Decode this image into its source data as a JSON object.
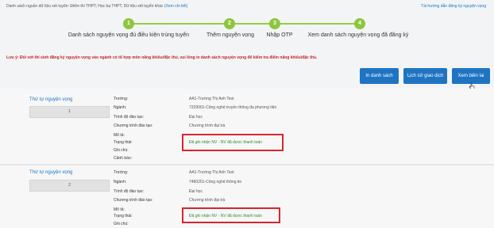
{
  "header": {
    "source_text": "Danh sách nguồn dữ liệu xét tuyển: Điểm thi THPT; Học bạ THPT; Dữ liệu xét tuyển khác",
    "detail_link": "(Xem chi tiết)",
    "guide_link": "Tài hướng dẫn đăng ký nguyện vọng"
  },
  "steps": [
    {
      "num": "1",
      "label": "Danh sách nguyện vọng đủ điều kiện trúng tuyển"
    },
    {
      "num": "2",
      "label": "Thêm nguyện vọng"
    },
    {
      "num": "3",
      "label": "Nhập OTP"
    },
    {
      "num": "4",
      "label": "Xem danh sách nguyện vọng đã đăng ký"
    }
  ],
  "colors": {
    "accent": "#1f74c2",
    "step": "#8dc63f",
    "warning": "#c0262d",
    "highlight_border": "#d7262e"
  },
  "warning": {
    "prefix": "Lưu ý:",
    "text": "Đối với thí sinh đăng ký nguyện vọng vào ngành có tổ hợp môn năng khiếu/đặc thù, vui lòng in danh sách nguyện vọng để kiểm tra điểm năng khiếu/đặc thù."
  },
  "buttons": {
    "print": "In danh sách",
    "history": "Lịch sử giao dịch",
    "receipt": "Xem biên lai"
  },
  "labels": {
    "order": "Thứ tự nguyện vọng",
    "school": "Trường:",
    "major": "Ngành:",
    "level": "Trình độ đào tạo:",
    "program": "Chương trình đào tạo:",
    "desc": "Mô tả:",
    "status": "Trạng thái:",
    "note": "Ghi chú:",
    "alert": "Cảnh báo:"
  },
  "wishes": [
    {
      "order": "1",
      "school": "AA1-Trường Thị Anh Test",
      "major": "7329001-Công nghệ truyền thông đa phương tiện",
      "level": "Đại học",
      "program": "Chương trình đại trà",
      "status": "Đã ghi nhận NV - NV đã được thanh toán"
    },
    {
      "order": "2",
      "school": "AA1-Trường Thị Anh Test",
      "major": "7480201-Công nghệ thông tin",
      "level": "Đại học",
      "program": "Chương trình đại trà",
      "status": "Đã ghi nhận NV - NV đã được thanh toán"
    }
  ]
}
